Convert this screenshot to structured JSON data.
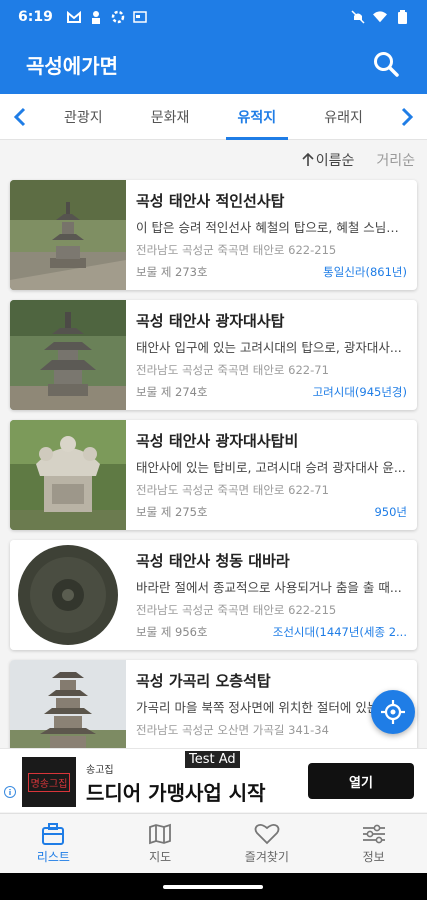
{
  "status": {
    "time": "6:19"
  },
  "app": {
    "title": "곡성에가면"
  },
  "tabs": [
    {
      "label": "관광지",
      "active": false
    },
    {
      "label": "문화재",
      "active": false
    },
    {
      "label": "유적지",
      "active": true
    },
    {
      "label": "유래지",
      "active": false
    }
  ],
  "sort": {
    "name": "이름순",
    "distance": "거리순"
  },
  "items": [
    {
      "title": "곡성 태안사 적인선사탑",
      "desc": "이 탑은 승려 적인선사 혜철의 탑으로, 혜철 스님의...",
      "addr": "전라남도 곡성군 죽곡면 태안로 622-215",
      "num": "보물 제 273호",
      "era": "통일신라(861년)"
    },
    {
      "title": "곡성 태안사 광자대사탑",
      "desc": "태안사 입구에 있는 고려시대의 탑으로, 광자대사...",
      "addr": "전라남도 곡성군 죽곡면 태안로 622-71",
      "num": "보물 제 274호",
      "era": "고려시대(945년경)"
    },
    {
      "title": "곡성 태안사 광자대사탑비",
      "desc": "태안사에 있는 탑비로, 고려시대 승려 광자대사 윤...",
      "addr": "전라남도 곡성군 죽곡면 태안로 622-71",
      "num": "보물 제 275호",
      "era": "950년"
    },
    {
      "title": "곡성 태안사 청동 대바라",
      "desc": "바라란 절에서 종교적으로 사용되거나 춤을 출 때...",
      "addr": "전라남도 곡성군 죽곡면 태안로 622-215",
      "num": "보물 제 956호",
      "era": "조선시대(1447년(세종 2..."
    },
    {
      "title": "곡성 가곡리 오층석탑",
      "desc": "가곡리 마을 북쪽 정사면에 위치한 절터에 있는...",
      "addr": "전라남도 곡성군 오산면 가곡길 341-34",
      "num": "",
      "era": ""
    }
  ],
  "ad": {
    "badge": "Test Ad",
    "logo_text": "명송그집",
    "small": "송고집",
    "headline": "드디어 가맹사업 시작",
    "button": "열기"
  },
  "nav": [
    {
      "label": "리스트",
      "icon": "list-icon",
      "active": true
    },
    {
      "label": "지도",
      "icon": "map-icon",
      "active": false
    },
    {
      "label": "즐겨찾기",
      "icon": "heart-icon",
      "active": false
    },
    {
      "label": "정보",
      "icon": "settings-icon",
      "active": false
    }
  ],
  "colors": {
    "primary": "#1f7de6",
    "era": "#1f7de6"
  }
}
